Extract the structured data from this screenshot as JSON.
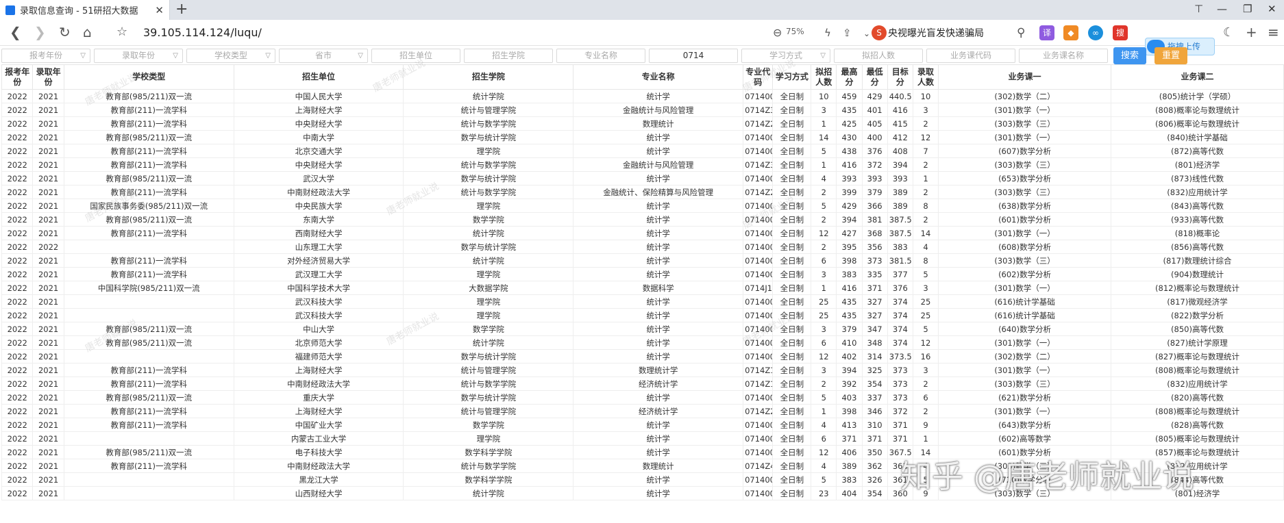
{
  "browser": {
    "tab_title": "录取信息查询 - 51研招大数据",
    "url": "39.105.114.124/luqu/",
    "zoom": "75%",
    "news": "央视曝光盲发快递骗局",
    "upload_label": "拖拽上传"
  },
  "filters": [
    "报考年份",
    "录取年份",
    "学校类型",
    "省市",
    "招生单位",
    "招生学院",
    "专业名称",
    "0714",
    "学习方式",
    "拟招人数",
    "业务课代码",
    "业务课名称"
  ],
  "buttons": {
    "search": "搜索",
    "reset": "重置"
  },
  "columns": [
    "报考年份",
    "录取年份",
    "学校类型",
    "招生单位",
    "招生学院",
    "专业名称",
    "专业代码",
    "学习方式",
    "拟招人数",
    "最高分",
    "最低分",
    "目标分",
    "录取人数",
    "业务课一",
    "业务课二"
  ],
  "rows": [
    [
      "2022",
      "2021",
      "教育部(985/211)双一流",
      "中国人民大学",
      "统计学院",
      "统计学",
      "071400",
      "全日制",
      "10",
      "459",
      "429",
      "440.5",
      "10",
      "(302)数学（二）",
      "(805)统计学（学硕）"
    ],
    [
      "2022",
      "2021",
      "教育部(211)一流学科",
      "上海财经大学",
      "统计与管理学院",
      "金融统计与风险管理",
      "0714Z3",
      "全日制",
      "3",
      "435",
      "401",
      "416",
      "3",
      "(301)数学（一）",
      "(808)概率论与数理统计"
    ],
    [
      "2022",
      "2021",
      "教育部(211)一流学科",
      "中央财经大学",
      "统计与数学学院",
      "数理统计",
      "0714Z2",
      "全日制",
      "1",
      "425",
      "405",
      "415",
      "2",
      "(303)数学（三）",
      "(806)概率论与数理统计"
    ],
    [
      "2022",
      "2021",
      "教育部(985/211)双一流",
      "中南大学",
      "数学与统计学院",
      "统计学",
      "071400",
      "全日制",
      "14",
      "430",
      "400",
      "412",
      "12",
      "(301)数学（一）",
      "(840)统计学基础"
    ],
    [
      "2022",
      "2021",
      "教育部(211)一流学科",
      "北京交通大学",
      "理学院",
      "统计学",
      "071400",
      "全日制",
      "5",
      "438",
      "376",
      "408",
      "7",
      "(607)数学分析",
      "(872)高等代数"
    ],
    [
      "2022",
      "2021",
      "教育部(211)一流学科",
      "中央财经大学",
      "统计与数学学院",
      "金融统计与风险管理",
      "0714Z3",
      "全日制",
      "1",
      "416",
      "372",
      "394",
      "2",
      "(303)数学（三）",
      "(801)经济学"
    ],
    [
      "2022",
      "2021",
      "教育部(985/211)双一流",
      "武汉大学",
      "数学与统计学院",
      "统计学",
      "071400",
      "全日制",
      "4",
      "393",
      "393",
      "393",
      "1",
      "(653)数学分析",
      "(873)线性代数"
    ],
    [
      "2022",
      "2021",
      "教育部(211)一流学科",
      "中南财经政法大学",
      "统计与数学学院",
      "金融统计、保险精算与风险管理",
      "0714Z2",
      "全日制",
      "2",
      "399",
      "379",
      "389",
      "2",
      "(303)数学（三）",
      "(832)应用统计学"
    ],
    [
      "2022",
      "2021",
      "国家民族事务委(985/211)双一流",
      "中央民族大学",
      "理学院",
      "统计学",
      "071400",
      "全日制",
      "5",
      "429",
      "366",
      "389",
      "8",
      "(638)数学分析",
      "(843)高等代数"
    ],
    [
      "2022",
      "2021",
      "教育部(985/211)双一流",
      "东南大学",
      "数学学院",
      "统计学",
      "071400",
      "全日制",
      "2",
      "394",
      "381",
      "387.5",
      "2",
      "(601)数学分析",
      "(933)高等代数"
    ],
    [
      "2022",
      "2021",
      "教育部(211)一流学科",
      "西南财经大学",
      "统计学院",
      "统计学",
      "071400",
      "全日制",
      "12",
      "427",
      "368",
      "387.5",
      "14",
      "(301)数学（一）",
      "(818)概率论"
    ],
    [
      "2022",
      "2022",
      "",
      "山东理工大学",
      "数学与统计学院",
      "统计学",
      "071400",
      "全日制",
      "2",
      "395",
      "356",
      "383",
      "4",
      "(608)数学分析",
      "(856)高等代数"
    ],
    [
      "2022",
      "2021",
      "教育部(211)一流学科",
      "对外经济贸易大学",
      "统计学院",
      "统计学",
      "071400",
      "全日制",
      "6",
      "398",
      "373",
      "381.5",
      "8",
      "(303)数学（三）",
      "(817)数理统计综合"
    ],
    [
      "2022",
      "2021",
      "教育部(211)一流学科",
      "武汉理工大学",
      "理学院",
      "统计学",
      "071400",
      "全日制",
      "3",
      "383",
      "335",
      "377",
      "5",
      "(602)数学分析",
      "(904)数理统计"
    ],
    [
      "2022",
      "2021",
      "中国科学院(985/211)双一流",
      "中国科学技术大学",
      "大数据学院",
      "数据科学",
      "0714J1",
      "全日制",
      "1",
      "416",
      "371",
      "376",
      "3",
      "(301)数学（一）",
      "(812)概率论与数理统计"
    ],
    [
      "2022",
      "2021",
      "",
      "武汉科技大学",
      "理学院",
      "统计学",
      "071400",
      "全日制",
      "25",
      "435",
      "327",
      "374",
      "25",
      "(616)统计学基础",
      "(817)微观经济学"
    ],
    [
      "2022",
      "2021",
      "",
      "武汉科技大学",
      "理学院",
      "统计学",
      "071400",
      "全日制",
      "25",
      "435",
      "327",
      "374",
      "25",
      "(616)统计学基础",
      "(822)数学分析"
    ],
    [
      "2022",
      "2021",
      "教育部(985/211)双一流",
      "中山大学",
      "数学学院",
      "统计学",
      "071400",
      "全日制",
      "3",
      "379",
      "347",
      "374",
      "5",
      "(640)数学分析",
      "(850)高等代数"
    ],
    [
      "2022",
      "2021",
      "教育部(985/211)双一流",
      "北京师范大学",
      "统计学院",
      "统计学",
      "071400",
      "全日制",
      "6",
      "410",
      "348",
      "374",
      "12",
      "(301)数学（一）",
      "(827)统计学原理"
    ],
    [
      "2022",
      "2021",
      "",
      "福建师范大学",
      "数学与统计学院",
      "统计学",
      "071400",
      "全日制",
      "12",
      "402",
      "314",
      "373.5",
      "16",
      "(302)数学（二）",
      "(827)概率论与数理统计"
    ],
    [
      "2022",
      "2021",
      "教育部(211)一流学科",
      "上海财经大学",
      "统计与管理学院",
      "数理统计学",
      "0714Z1",
      "全日制",
      "3",
      "394",
      "325",
      "373",
      "3",
      "(301)数学（一）",
      "(808)概率论与数理统计"
    ],
    [
      "2022",
      "2021",
      "教育部(211)一流学科",
      "中南财经政法大学",
      "统计与数学学院",
      "经济统计学",
      "0714Z1",
      "全日制",
      "2",
      "392",
      "354",
      "373",
      "2",
      "(303)数学（三）",
      "(832)应用统计学"
    ],
    [
      "2022",
      "2021",
      "教育部(985/211)双一流",
      "重庆大学",
      "数学与统计学院",
      "统计学",
      "071400",
      "全日制",
      "5",
      "403",
      "337",
      "373",
      "6",
      "(621)数学分析",
      "(820)高等代数"
    ],
    [
      "2022",
      "2021",
      "教育部(211)一流学科",
      "上海财经大学",
      "统计与管理学院",
      "经济统计学",
      "0714Z2",
      "全日制",
      "1",
      "398",
      "346",
      "372",
      "2",
      "(301)数学（一）",
      "(808)概率论与数理统计"
    ],
    [
      "2022",
      "2021",
      "教育部(211)一流学科",
      "中国矿业大学",
      "数学学院",
      "统计学",
      "071400",
      "全日制",
      "4",
      "413",
      "310",
      "371",
      "9",
      "(643)数学分析",
      "(828)高等代数"
    ],
    [
      "2022",
      "2021",
      "",
      "内蒙古工业大学",
      "理学院",
      "统计学",
      "071400",
      "全日制",
      "6",
      "371",
      "371",
      "371",
      "1",
      "(602)高等数学",
      "(805)概率论与数理统计"
    ],
    [
      "2022",
      "2021",
      "教育部(985/211)双一流",
      "电子科技大学",
      "数学科学学院",
      "统计学",
      "071400",
      "全日制",
      "12",
      "406",
      "350",
      "367.5",
      "14",
      "(601)数学分析",
      "(857)概率论与数理统计"
    ],
    [
      "2022",
      "2021",
      "教育部(211)一流学科",
      "中南财经政法大学",
      "统计与数学学院",
      "数理统计",
      "0714Z4",
      "全日制",
      "4",
      "389",
      "362",
      "363",
      "4",
      "(303)数学（三）",
      "(832)应用统计学"
    ],
    [
      "2022",
      "2021",
      "",
      "黑龙江大学",
      "数学科学学院",
      "统计学",
      "071400",
      "全日制",
      "5",
      "383",
      "326",
      "361",
      "5",
      "(720)数学分析",
      "(844)高等代数"
    ],
    [
      "2022",
      "2021",
      "",
      "山西财经大学",
      "统计学院",
      "统计学",
      "071400",
      "全日制",
      "23",
      "404",
      "354",
      "360",
      "9",
      "(303)数学（三）",
      "(801)经济学"
    ]
  ],
  "watermark": "唐老师就业说",
  "zhihu_watermark": "知乎 @唐老师就业说"
}
